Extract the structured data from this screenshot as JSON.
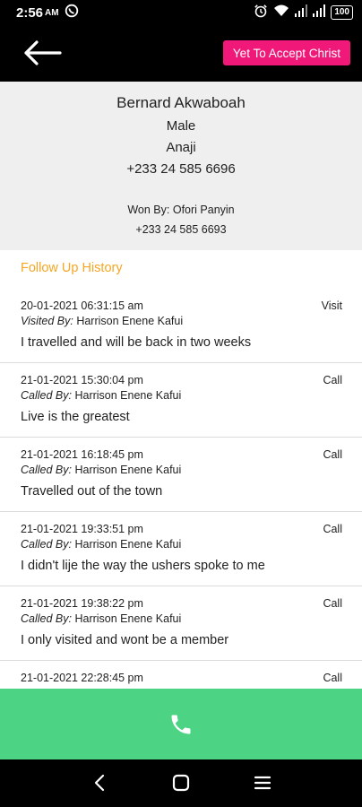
{
  "status_bar": {
    "time": "2:56",
    "ampm": "AM",
    "battery": "100",
    "icons": [
      "whatsapp-icon",
      "alarm-icon",
      "wifi-icon",
      "signal-icon",
      "signal-icon",
      "battery-icon"
    ]
  },
  "app_bar": {
    "back_icon": "arrow-left-icon",
    "status_label": "Yet To Accept Christ",
    "status_color": "#f0197a"
  },
  "profile": {
    "name": "Bernard Akwaboah",
    "gender": "Male",
    "town": "Anaji",
    "phone": "+233 24 585 6696",
    "won_by": "Won By: Ofori Panyin",
    "won_by_phone": "+233 24 585 6693"
  },
  "history": {
    "title": "Follow Up History",
    "title_color": "#f5a623",
    "entries": [
      {
        "date": "20-01-2021 06:31:15 am",
        "by_label": "Visited By:",
        "by_name": "Harrison Enene Kafui",
        "type": "Visit",
        "note": "I travelled and will be back in two weeks"
      },
      {
        "date": "21-01-2021 15:30:04 pm",
        "by_label": "Called By:",
        "by_name": "Harrison Enene Kafui",
        "type": "Call",
        "note": "Live is the greatest"
      },
      {
        "date": "21-01-2021 16:18:45 pm",
        "by_label": "Called By:",
        "by_name": "Harrison Enene Kafui",
        "type": "Call",
        "note": "Travelled out of the town"
      },
      {
        "date": "21-01-2021 19:33:51 pm",
        "by_label": "Called By:",
        "by_name": "Harrison Enene Kafui",
        "type": "Call",
        "note": "I didn't lije the way the ushers spoke to me"
      },
      {
        "date": "21-01-2021 19:38:22 pm",
        "by_label": "Called By:",
        "by_name": "Harrison Enene Kafui",
        "type": "Call",
        "note": "I only visited and wont be a member"
      },
      {
        "date": "21-01-2021 22:28:45 pm",
        "by_label": "",
        "by_name": "",
        "type": "Call",
        "note": ""
      }
    ]
  },
  "call_bar": {
    "icon": "phone-icon",
    "color": "#4cd384"
  },
  "nav_bar": {
    "icons": [
      "back-icon",
      "home-icon",
      "menu-icon"
    ]
  }
}
